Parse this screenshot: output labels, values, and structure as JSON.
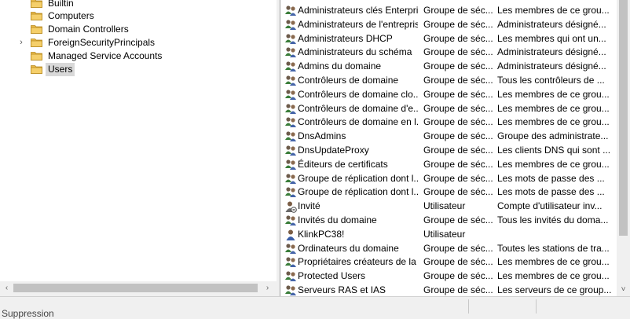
{
  "tree": {
    "items": [
      {
        "label": "Builtin",
        "expandable": false,
        "selected": false
      },
      {
        "label": "Computers",
        "expandable": false,
        "selected": false
      },
      {
        "label": "Domain Controllers",
        "expandable": false,
        "selected": false
      },
      {
        "label": "ForeignSecurityPrincipals",
        "expandable": true,
        "selected": false
      },
      {
        "label": "Managed Service Accounts",
        "expandable": false,
        "selected": false
      },
      {
        "label": "Users",
        "expandable": false,
        "selected": true
      }
    ]
  },
  "list": {
    "rows": [
      {
        "name": "Administrateurs clés Enterprise",
        "type": "Groupe de séc...",
        "description": "Les membres de ce grou...",
        "icon": "group-icon"
      },
      {
        "name": "Administrateurs de l'entreprise",
        "type": "Groupe de séc...",
        "description": "Administrateurs désigné...",
        "icon": "group-icon"
      },
      {
        "name": "Administrateurs DHCP",
        "type": "Groupe de séc...",
        "description": "Les membres qui ont un...",
        "icon": "group-icon"
      },
      {
        "name": "Administrateurs du schéma",
        "type": "Groupe de séc...",
        "description": "Administrateurs désigné...",
        "icon": "group-icon"
      },
      {
        "name": "Admins du domaine",
        "type": "Groupe de séc...",
        "description": "Administrateurs désigné...",
        "icon": "group-icon"
      },
      {
        "name": "Contrôleurs de domaine",
        "type": "Groupe de séc...",
        "description": "Tous les contrôleurs de ...",
        "icon": "group-icon"
      },
      {
        "name": "Contrôleurs de domaine clo...",
        "type": "Groupe de séc...",
        "description": "Les membres de ce grou...",
        "icon": "group-icon"
      },
      {
        "name": "Contrôleurs de domaine d'e...",
        "type": "Groupe de séc...",
        "description": "Les membres de ce grou...",
        "icon": "group-icon"
      },
      {
        "name": "Contrôleurs de domaine en l...",
        "type": "Groupe de séc...",
        "description": "Les membres de ce grou...",
        "icon": "group-icon"
      },
      {
        "name": "DnsAdmins",
        "type": "Groupe de séc...",
        "description": "Groupe des administrate...",
        "icon": "group-icon"
      },
      {
        "name": "DnsUpdateProxy",
        "type": "Groupe de séc...",
        "description": "Les clients DNS qui sont ...",
        "icon": "group-icon"
      },
      {
        "name": "Éditeurs de certificats",
        "type": "Groupe de séc...",
        "description": "Les membres de ce grou...",
        "icon": "group-icon"
      },
      {
        "name": "Groupe de réplication dont l...",
        "type": "Groupe de séc...",
        "description": "Les mots de passe des ...",
        "icon": "group-icon"
      },
      {
        "name": "Groupe de réplication dont l...",
        "type": "Groupe de séc...",
        "description": "Les mots de passe des ...",
        "icon": "group-icon"
      },
      {
        "name": "Invité",
        "type": "Utilisateur",
        "description": "Compte d'utilisateur inv...",
        "icon": "disabled-user-icon"
      },
      {
        "name": "Invités du domaine",
        "type": "Groupe de séc...",
        "description": "Tous les invités du doma...",
        "icon": "group-icon"
      },
      {
        "name": "KlinkPC38!",
        "type": "Utilisateur",
        "description": "",
        "icon": "user-icon"
      },
      {
        "name": "Ordinateurs du domaine",
        "type": "Groupe de séc...",
        "description": "Toutes les stations de tra...",
        "icon": "group-icon"
      },
      {
        "name": "Propriétaires créateurs de la s...",
        "type": "Groupe de séc...",
        "description": "Les membres de ce grou...",
        "icon": "group-icon"
      },
      {
        "name": "Protected Users",
        "type": "Groupe de séc...",
        "description": "Les membres de ce grou...",
        "icon": "group-icon"
      },
      {
        "name": "Serveurs RAS et IAS",
        "type": "Groupe de séc...",
        "description": "Les serveurs de ce group...",
        "icon": "group-icon"
      }
    ]
  },
  "colors": {
    "selection": "#d9d9d9",
    "folder": "#e8b94a",
    "scrollbar_thumb": "#c2c2c2"
  },
  "status": {
    "text": "Suppression"
  },
  "icons": {
    "expand": "›",
    "scroll_left": "‹",
    "scroll_right": "›",
    "scroll_down": "˅"
  }
}
